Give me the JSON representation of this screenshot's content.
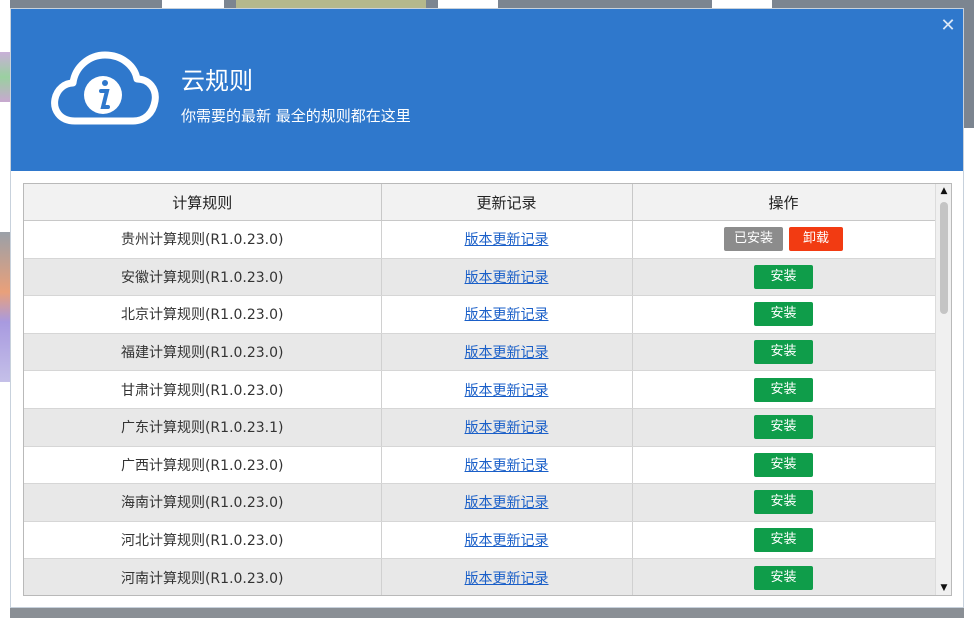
{
  "dialog": {
    "title": "云规则",
    "subtitle": "你需要的最新 最全的规则都在这里",
    "close_glyph": "✕"
  },
  "table": {
    "headers": [
      "计算规则",
      "更新记录",
      "操作"
    ],
    "rows": [
      {
        "rule": "贵州计算规则(R1.0.23.0)",
        "log": "版本更新记录",
        "installed": true,
        "installed_label": "已安装",
        "uninstall_label": "卸载"
      },
      {
        "rule": "安徽计算规则(R1.0.23.0)",
        "log": "版本更新记录",
        "installed": false,
        "install_label": "安装"
      },
      {
        "rule": "北京计算规则(R1.0.23.0)",
        "log": "版本更新记录",
        "installed": false,
        "install_label": "安装"
      },
      {
        "rule": "福建计算规则(R1.0.23.0)",
        "log": "版本更新记录",
        "installed": false,
        "install_label": "安装"
      },
      {
        "rule": "甘肃计算规则(R1.0.23.0)",
        "log": "版本更新记录",
        "installed": false,
        "install_label": "安装"
      },
      {
        "rule": "广东计算规则(R1.0.23.1)",
        "log": "版本更新记录",
        "installed": false,
        "install_label": "安装"
      },
      {
        "rule": "广西计算规则(R1.0.23.0)",
        "log": "版本更新记录",
        "installed": false,
        "install_label": "安装"
      },
      {
        "rule": "海南计算规则(R1.0.23.0)",
        "log": "版本更新记录",
        "installed": false,
        "install_label": "安装"
      },
      {
        "rule": "河北计算规则(R1.0.23.0)",
        "log": "版本更新记录",
        "installed": false,
        "install_label": "安装"
      },
      {
        "rule": "河南计算规则(R1.0.23.0)",
        "log": "版本更新记录",
        "installed": false,
        "install_label": "安装"
      }
    ]
  },
  "icons": {
    "cloud": "cloud-info-icon",
    "scroll_up": "▲",
    "scroll_down": "▼"
  },
  "colors": {
    "header_blue": "#2f78cc",
    "install_green": "#0f9d4a",
    "uninstall_red": "#f23b12",
    "installed_gray": "#8c8c8c",
    "link_blue": "#1a5fc8"
  }
}
